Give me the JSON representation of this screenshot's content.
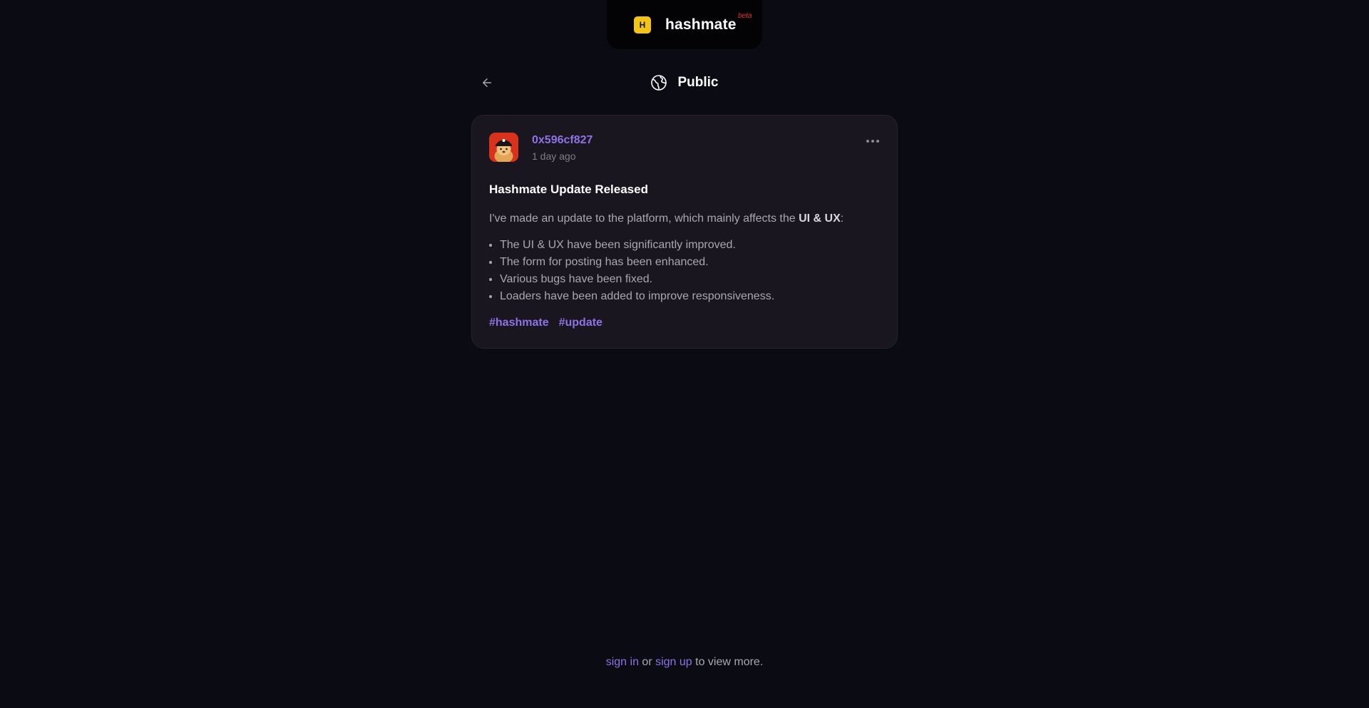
{
  "brand": {
    "logo_letter": "H",
    "name": "hashmate",
    "badge": "beta"
  },
  "header": {
    "title": "Public",
    "back_icon": "arrow-left-icon",
    "title_icon": "globe-icon"
  },
  "post": {
    "author": "0x596cf827",
    "time": "1 day ago",
    "title": "Hashmate Update Released",
    "intro_prefix": "I've made an update to the platform, which mainly affects the ",
    "intro_bold": "UI & UX",
    "intro_suffix": ":",
    "bullets": [
      "The UI & UX have been significantly improved.",
      "The form for posting has been enhanced.",
      "Various bugs have been fixed.",
      "Loaders have been added to improve responsiveness."
    ],
    "tags": [
      "#hashmate",
      "#update"
    ],
    "menu_icon": "more-horizontal-icon"
  },
  "footer": {
    "sign_in": "sign in",
    "or": " or ",
    "sign_up": "sign up",
    "suffix": " to view more."
  },
  "colors": {
    "background": "#0b0b13",
    "card": "#19161f",
    "accent": "#8f73e6",
    "logo": "#f3c414",
    "beta": "#e3343a"
  }
}
